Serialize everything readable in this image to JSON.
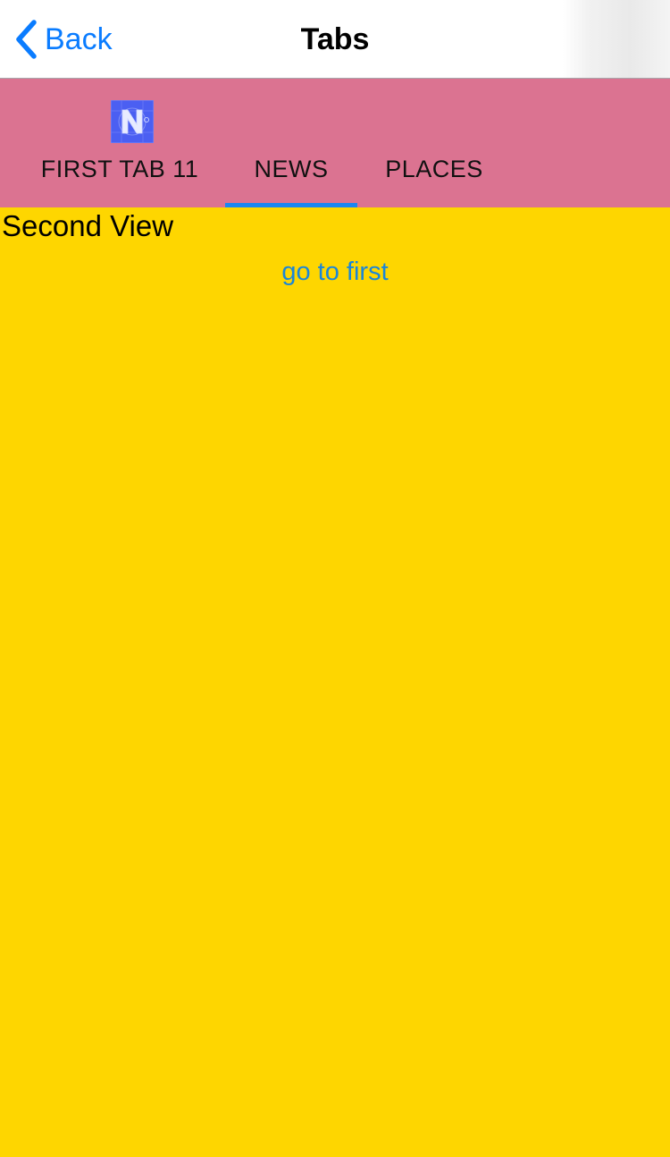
{
  "navbar": {
    "back_label": "Back",
    "title": "Tabs"
  },
  "tabs": [
    {
      "label": "FIRST TAB 11",
      "icon": "nativescript-logo-icon",
      "selected": false
    },
    {
      "label": "NEWS",
      "icon": null,
      "selected": true
    },
    {
      "label": "PLACES",
      "icon": null,
      "selected": false
    }
  ],
  "content": {
    "view_title": "Second View",
    "link_label": "go to first"
  },
  "colors": {
    "accent": "#0a7cff",
    "tab_strip": "#db7391",
    "tab_indicator": "#1a86f2",
    "content_background": "#fed600",
    "link": "#1a86d8"
  }
}
